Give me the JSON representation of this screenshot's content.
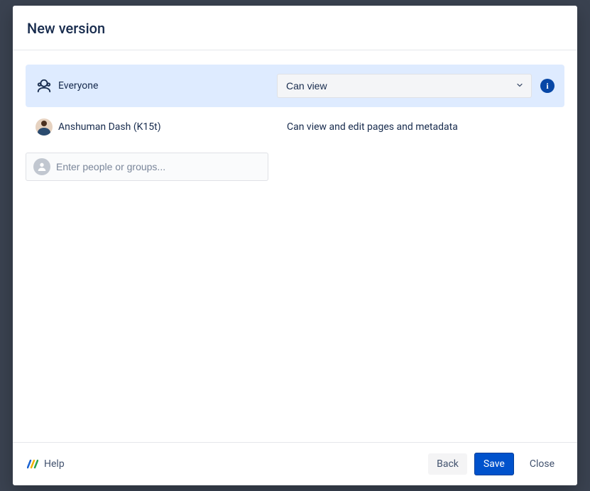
{
  "modal": {
    "title": "New version"
  },
  "permissions": {
    "everyone": {
      "label": "Everyone",
      "selected": "Can view"
    },
    "user": {
      "name": "Anshuman Dash (K15t)",
      "permission": "Can view and edit pages and metadata"
    },
    "search": {
      "placeholder": "Enter people or groups..."
    }
  },
  "footer": {
    "help": "Help",
    "back": "Back",
    "save": "Save",
    "close": "Close"
  }
}
